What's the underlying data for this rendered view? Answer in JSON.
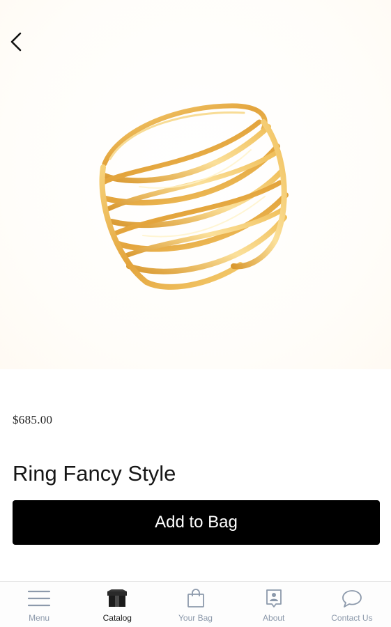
{
  "product": {
    "price": "$685.00",
    "title": "Ring Fancy Style",
    "image_alt": "gold-ring-photo"
  },
  "actions": {
    "add_to_bag_label": "Add to Bag"
  },
  "tabbar": {
    "items": [
      {
        "label": "Menu",
        "icon": "menu-icon",
        "active": false
      },
      {
        "label": "Catalog",
        "icon": "catalog-box-icon",
        "active": true
      },
      {
        "label": "Your Bag",
        "icon": "shopping-bag-icon",
        "active": false
      },
      {
        "label": "About",
        "icon": "about-contact-card-icon",
        "active": false
      },
      {
        "label": "Contact Us",
        "icon": "chat-bubble-icon",
        "active": false
      }
    ]
  },
  "colors": {
    "button_bg": "#000000",
    "button_text": "#ffffff",
    "tab_inactive": "#8c99ab",
    "tab_active": "#1b1b1b",
    "gold": "#e9b24e"
  }
}
